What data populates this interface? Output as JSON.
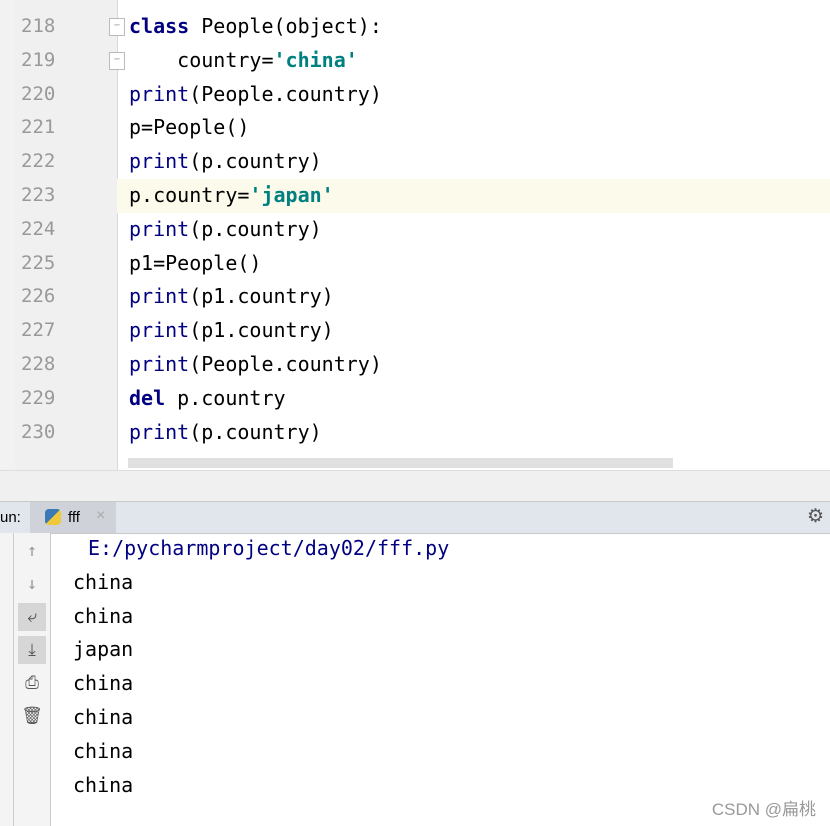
{
  "editor": {
    "lines": [
      {
        "n": "218",
        "tokens": [
          {
            "t": "class",
            "k": "kw"
          },
          {
            "t": " People(object):",
            "k": ""
          }
        ],
        "fold": true
      },
      {
        "n": "219",
        "tokens": [
          {
            "t": "    country=",
            "k": ""
          },
          {
            "t": "'china'",
            "k": "str"
          }
        ],
        "fold": true
      },
      {
        "n": "220",
        "tokens": [
          {
            "t": "print",
            "k": "bi"
          },
          {
            "t": "(People.country)",
            "k": ""
          }
        ]
      },
      {
        "n": "221",
        "tokens": [
          {
            "t": "p=People()",
            "k": ""
          }
        ]
      },
      {
        "n": "222",
        "tokens": [
          {
            "t": "print",
            "k": "bi"
          },
          {
            "t": "(p.country)",
            "k": ""
          }
        ]
      },
      {
        "n": "223",
        "tokens": [
          {
            "t": "p.country=",
            "k": ""
          },
          {
            "t": "'japan'",
            "k": "str"
          }
        ],
        "current": true
      },
      {
        "n": "224",
        "tokens": [
          {
            "t": "print",
            "k": "bi"
          },
          {
            "t": "(p.country)",
            "k": ""
          }
        ]
      },
      {
        "n": "225",
        "tokens": [
          {
            "t": "p1=People()",
            "k": ""
          }
        ]
      },
      {
        "n": "226",
        "tokens": [
          {
            "t": "print",
            "k": "bi"
          },
          {
            "t": "(p1.country)",
            "k": ""
          }
        ]
      },
      {
        "n": "227",
        "tokens": [
          {
            "t": "print",
            "k": "bi"
          },
          {
            "t": "(p1.country)",
            "k": ""
          }
        ]
      },
      {
        "n": "228",
        "tokens": [
          {
            "t": "print",
            "k": "bi"
          },
          {
            "t": "(People.country)",
            "k": ""
          }
        ]
      },
      {
        "n": "229",
        "tokens": [
          {
            "t": "del",
            "k": "kw"
          },
          {
            "t": " p.country",
            "k": ""
          }
        ]
      },
      {
        "n": "230",
        "tokens": [
          {
            "t": "print",
            "k": "bi"
          },
          {
            "t": "(p.country)",
            "k": ""
          }
        ]
      }
    ]
  },
  "run": {
    "label": "un:",
    "tab": "fff",
    "close": "×"
  },
  "console": {
    "path": "E:/pycharmproject/day02/fff.py",
    "output": [
      "china",
      "china",
      "japan",
      "china",
      "china",
      "china",
      "china"
    ]
  },
  "watermark": "CSDN @扁桃"
}
